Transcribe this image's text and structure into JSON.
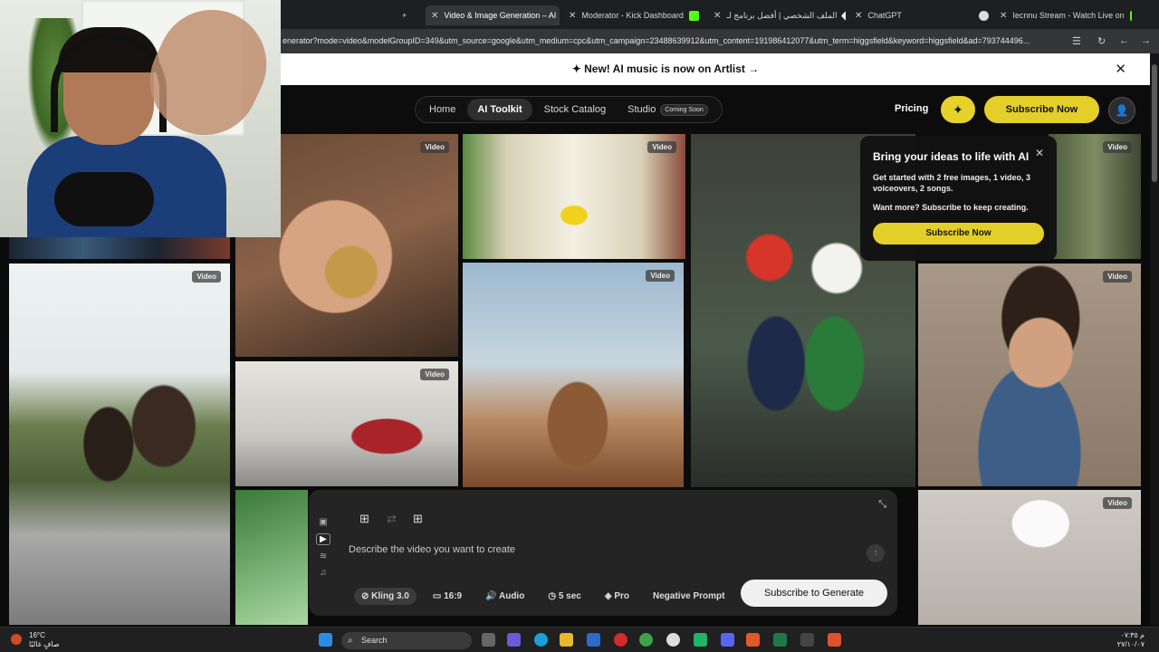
{
  "browser": {
    "tabs": [
      {
        "label": "Video & Image Generation – AI",
        "active": true
      },
      {
        "label": "Moderator - Kick Dashboard",
        "active": false
      },
      {
        "label": "الملف الشخصي | أفضل برنامج لـ",
        "active": false
      },
      {
        "label": "ChatGPT",
        "active": false
      },
      {
        "label": "Iecnnu Stream - Watch Live on",
        "active": false
      }
    ],
    "new_tab_symbol": "+",
    "close_symbol": "✕",
    "url": "enerator?mode=video&modelGroupID=349&utm_source=google&utm_medium=cpc&utm_campaign=23488639912&utm_content=191986412077&utm_term=higgsfield&keyword=higgsfield&ad=793744496..."
  },
  "announcement": {
    "text": "✦ New! AI music is now on Artlist →",
    "close_symbol": "✕"
  },
  "nav": {
    "items": [
      "Home",
      "AI Toolkit",
      "Stock Catalog",
      "Studio"
    ],
    "active": "AI Toolkit",
    "studio_badge": "Coming Soon",
    "pricing": "Pricing",
    "spark_symbol": "✦",
    "subscribe": "Subscribe Now",
    "avatar_symbol": "👤"
  },
  "gallery": {
    "badge": "Video"
  },
  "promo": {
    "title": "Bring your ideas to life with AI",
    "body": "Get started with 2 free images, 1 video, 3 voiceovers, 2 songs.",
    "body2": "Want more? Subscribe to keep creating.",
    "button": "Subscribe Now",
    "close_symbol": "✕"
  },
  "prompt": {
    "placeholder": "Describe the video you want to create",
    "options": [
      "Kling 3.0",
      "16:9",
      "Audio",
      "5 sec",
      "Pro",
      "Negative Prompt"
    ],
    "option_icons": [
      "⊘",
      "▭",
      "🔊",
      "◷",
      "◈",
      ""
    ],
    "generate": "Subscribe to Generate",
    "collapse_symbol": "⤡",
    "send_symbol": "↑"
  },
  "taskbar": {
    "temperature": "16°C",
    "weather": "صافٍ غالبًا",
    "search": "Search",
    "time": "م ٠٧:٣٥",
    "date": "٢٧/١٠/٠٧"
  },
  "colors": {
    "accent_yellow": "#e4cf2a",
    "background": "#0b0b0b"
  }
}
